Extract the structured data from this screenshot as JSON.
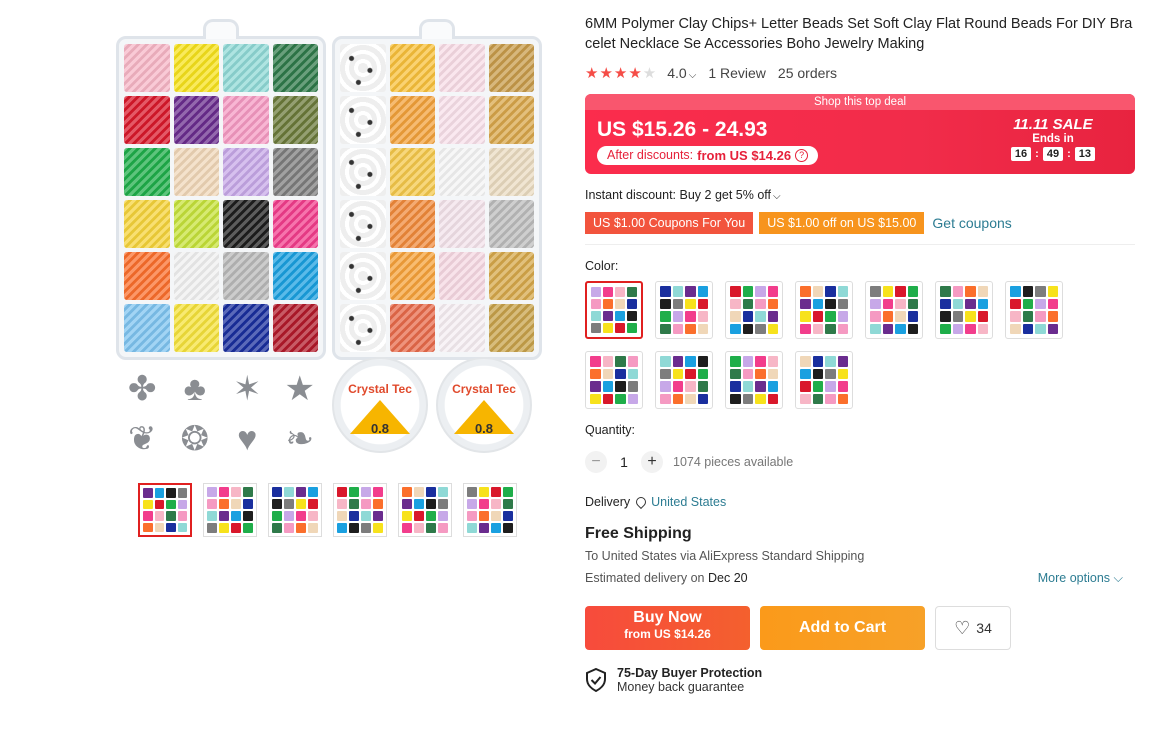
{
  "product": {
    "title": "6MM Polymer Clay Chips+ Letter Beads Set Soft Clay Flat Round Beads For DIY Bracelet Necklace Se Accessories Boho Jewelry Making",
    "rating": "4.0",
    "reviews": "1 Review",
    "orders": "25 orders",
    "stars_filled": 4
  },
  "gallery": {
    "spool_brand": "Crystal Tec",
    "spool_size": "0.8",
    "thumbnails_count": 6,
    "active_thumbnail": 0
  },
  "deal": {
    "banner": "Shop this top deal",
    "price": "US $15.26 - 24.93",
    "after_label": "After discounts:",
    "after_value": "from US $14.26",
    "sale_title": "11.11 SALE",
    "ends_in": "Ends in",
    "timer": [
      "16",
      "49",
      "13"
    ]
  },
  "discounts": {
    "instant": "Instant discount: Buy 2 get 5% off",
    "coupon1": "US $1.00 Coupons For You",
    "coupon2": "US $1.00 off on US $15.00",
    "get_coupons": "Get coupons"
  },
  "options": {
    "color_label": "Color:",
    "swatch_count": 11,
    "selected_swatch": 0,
    "quantity_label": "Quantity:",
    "quantity": "1",
    "available": "1074 pieces available",
    "minus": "−",
    "plus": "+"
  },
  "shipping": {
    "delivery_label": "Delivery",
    "country": "United States",
    "title": "Free Shipping",
    "via": "To United States via AliExpress Standard Shipping",
    "estimated_label": "Estimated delivery on",
    "estimated_date": "Dec 20",
    "more_options": "More options"
  },
  "actions": {
    "buy_now": "Buy Now",
    "buy_sub": "from US $14.26",
    "add_to_cart": "Add to Cart",
    "wishlist_count": "34"
  },
  "protection": {
    "title": "75-Day Buyer Protection",
    "subtitle": "Money back guarantee"
  },
  "colors": {
    "accent_red": "#f12c4a",
    "link": "#2c7c92",
    "cart_orange": "#f7a128"
  }
}
